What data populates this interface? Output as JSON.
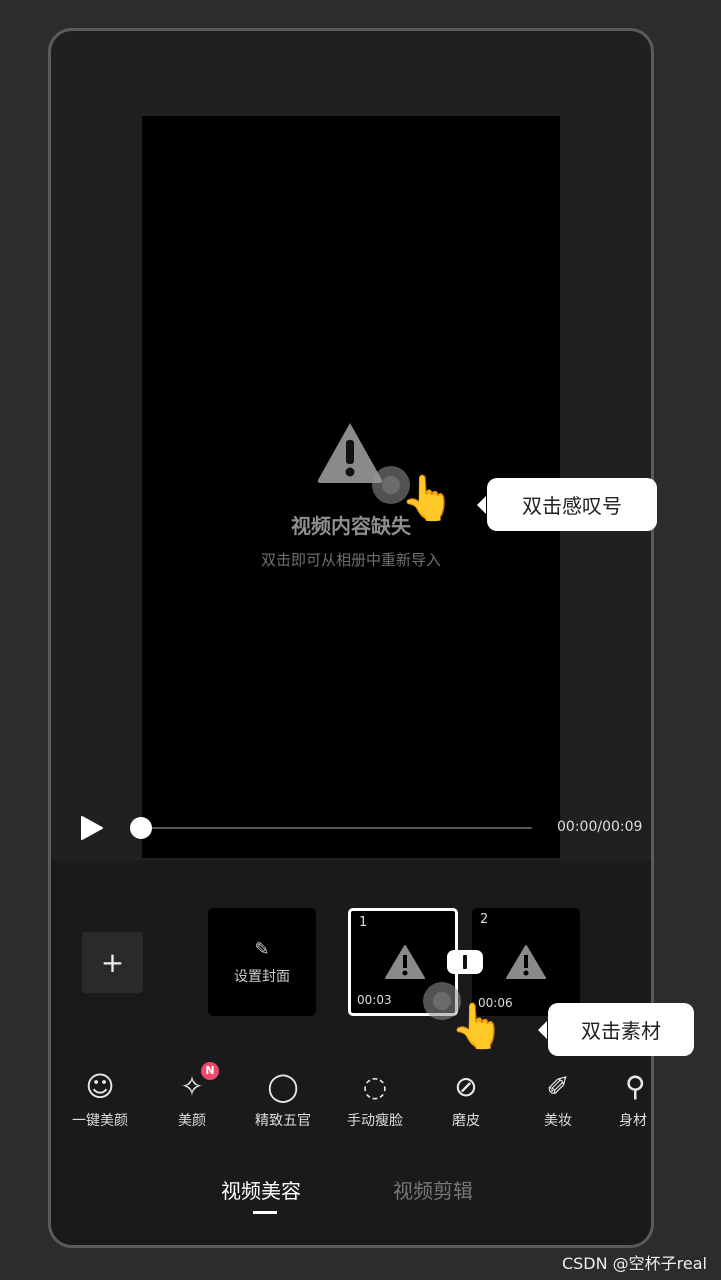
{
  "preview": {
    "missing_title": "视频内容缺失",
    "missing_hint": "双击即可从相册中重新导入",
    "time": "00:00/00:09",
    "playback_progress": 0
  },
  "tooltips": {
    "top": "双击感叹号",
    "bottom": "双击素材"
  },
  "timeline": {
    "add": "+",
    "cover_label": "设置封面",
    "clips": [
      {
        "index": "1",
        "duration": "00:03",
        "selected": true
      },
      {
        "index": "2",
        "duration": "00:06",
        "selected": false
      }
    ]
  },
  "tools": [
    {
      "icon": "face-outline-icon",
      "label": "一键美颜"
    },
    {
      "icon": "brush-sparkle-icon",
      "label": "美颜",
      "badge": "N"
    },
    {
      "icon": "mirror-face-icon",
      "label": "精致五官"
    },
    {
      "icon": "face-slim-icon",
      "label": "手动瘦脸"
    },
    {
      "icon": "smooth-skin-icon",
      "label": "磨皮"
    },
    {
      "icon": "lipstick-icon",
      "label": "美妆"
    },
    {
      "icon": "body-icon",
      "label": "身材"
    }
  ],
  "tabs": [
    {
      "label": "视频美容",
      "active": true
    },
    {
      "label": "视频剪辑",
      "active": false
    }
  ],
  "colors": {
    "badge": "#f0486a",
    "background": "#2c2c2e"
  },
  "watermark": "CSDN @空杯子real"
}
